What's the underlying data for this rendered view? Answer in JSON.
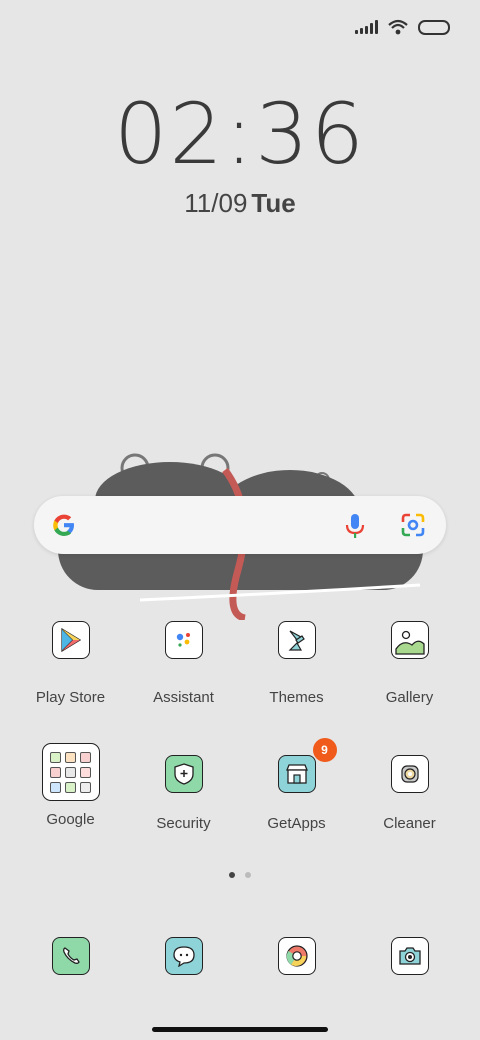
{
  "status": {
    "signal_icon": "signal-icon",
    "wifi_icon": "wifi-icon",
    "battery_icon": "battery-icon"
  },
  "clock": {
    "time": "02:36",
    "date": "11/09",
    "weekday": "Tue"
  },
  "search": {
    "logo": "google-g-icon",
    "mic": "mic-icon",
    "lens": "lens-icon"
  },
  "apps": [
    {
      "label": "Play Store",
      "icon": "play-store-icon"
    },
    {
      "label": "Assistant",
      "icon": "assistant-icon"
    },
    {
      "label": "Themes",
      "icon": "themes-icon"
    },
    {
      "label": "Gallery",
      "icon": "gallery-icon"
    },
    {
      "label": "Google",
      "icon": "google-folder-icon"
    },
    {
      "label": "Security",
      "icon": "security-icon"
    },
    {
      "label": "GetApps",
      "icon": "getapps-icon",
      "badge": "9"
    },
    {
      "label": "Cleaner",
      "icon": "cleaner-icon"
    }
  ],
  "dock": [
    {
      "icon": "phone-icon"
    },
    {
      "icon": "messages-icon"
    },
    {
      "icon": "chrome-icon"
    },
    {
      "icon": "camera-icon"
    }
  ],
  "pages": {
    "count": 2,
    "current": 1
  },
  "colors": {
    "background": "#e6e6e6",
    "badge": "#f05a1a",
    "green": "#8fd8a8",
    "teal": "#8ed3d8"
  }
}
